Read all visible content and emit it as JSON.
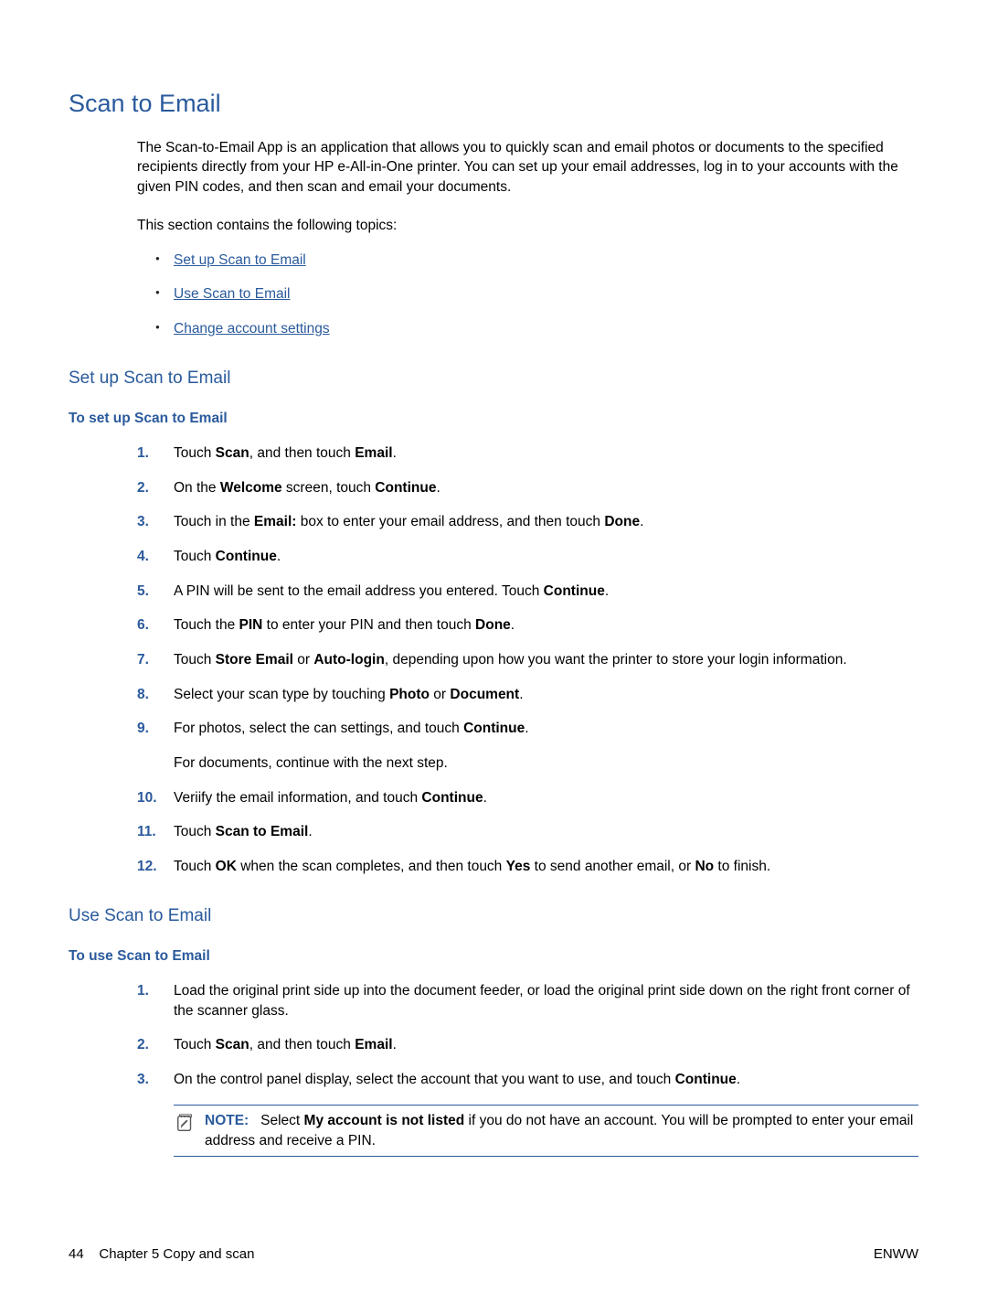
{
  "heading": "Scan to Email",
  "intro": "The Scan-to-Email App is an application that allows you to quickly scan and email photos or documents to the specified recipients directly from your HP e-All-in-One printer. You can set up your email addresses, log in to your accounts with the given PIN codes, and then scan and email your documents.",
  "section_intro": "This section contains the following topics:",
  "toc": {
    "item1": "Set up Scan to Email",
    "item2": "Use Scan to Email",
    "item3": "Change account settings"
  },
  "setup": {
    "heading": "Set up Scan to Email",
    "task_heading": "To set up Scan to Email",
    "steps": {
      "s1": {
        "pre": "Touch ",
        "b1": "Scan",
        "mid": ", and then touch ",
        "b2": "Email",
        "post": "."
      },
      "s2": {
        "pre": "On the ",
        "b1": "Welcome",
        "mid": " screen, touch ",
        "b2": "Continue",
        "post": "."
      },
      "s3": {
        "pre": "Touch in the ",
        "b1": "Email:",
        "mid": " box to enter your email address, and then touch ",
        "b2": "Done",
        "post": "."
      },
      "s4": {
        "pre": "Touch ",
        "b1": "Continue",
        "post": "."
      },
      "s5": {
        "pre": "A PIN will be sent to the email address you entered. Touch ",
        "b1": "Continue",
        "post": "."
      },
      "s6": {
        "pre": "Touch the ",
        "b1": "PIN",
        "mid": " to enter your PIN and then touch ",
        "b2": "Done",
        "post": "."
      },
      "s7": {
        "pre": "Touch ",
        "b1": "Store Email",
        "mid": " or ",
        "b2": "Auto-login",
        "post": ", depending upon how you want the printer to store your login information."
      },
      "s8": {
        "pre": "Select your scan type by touching ",
        "b1": "Photo",
        "mid": " or ",
        "b2": "Document",
        "post": "."
      },
      "s9": {
        "pre": "For photos, select the can settings, and touch ",
        "b1": "Continue",
        "post": ".",
        "sub": "For documents, continue with the next step."
      },
      "s10": {
        "pre": "Veriify the email information, and touch ",
        "b1": "Continue",
        "post": "."
      },
      "s11": {
        "pre": "Touch ",
        "b1": "Scan to Email",
        "post": "."
      },
      "s12": {
        "pre": "Touch ",
        "b1": "OK",
        "mid1": " when the scan completes, and then touch ",
        "b2": "Yes",
        "mid2": " to send another email, or ",
        "b3": "No",
        "post": " to finish."
      }
    }
  },
  "use": {
    "heading": "Use Scan to Email",
    "task_heading": "To use Scan to Email",
    "steps": {
      "s1": {
        "text": "Load the original print side up into the document feeder, or load the original print side down on the right front corner of the scanner glass."
      },
      "s2": {
        "pre": "Touch ",
        "b1": "Scan",
        "mid": ", and then touch ",
        "b2": "Email",
        "post": "."
      },
      "s3": {
        "pre": "On the control panel display, select the account that you want to use, and touch ",
        "b1": "Continue",
        "post": "."
      }
    },
    "note": {
      "label": "NOTE:",
      "pre": "Select ",
      "b1": "My account is not listed",
      "post": " if you do not have an account. You will be prompted to enter your email address and receive a PIN."
    }
  },
  "footer": {
    "page_num": "44",
    "chapter": "Chapter 5   Copy and scan",
    "right": "ENWW"
  }
}
